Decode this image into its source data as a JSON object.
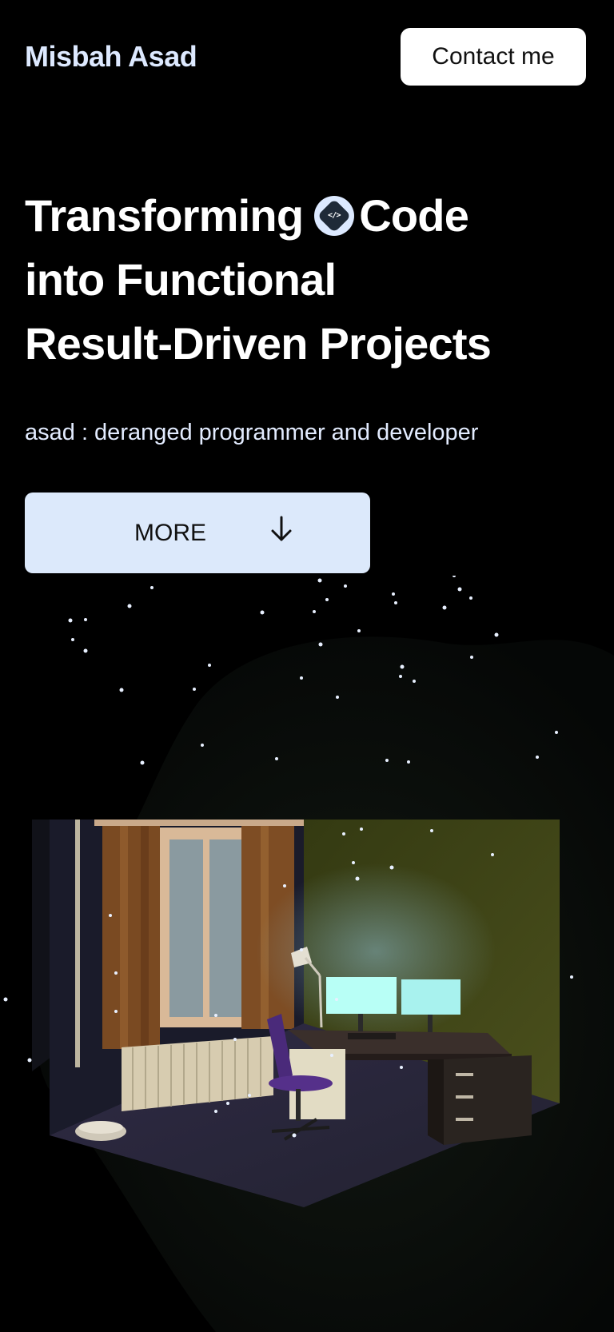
{
  "header": {
    "brand": "Misbah Asad",
    "contact_label": "Contact me"
  },
  "hero": {
    "line1_before_icon": "Transforming",
    "line1_after_icon": "Code",
    "line2": "into Functional",
    "line3": "Result-Driven Projects",
    "badge_text": "</>",
    "tagline": "asad : deranged programmer and developer"
  },
  "cta": {
    "more_label": "MORE",
    "more_icon": "arrow-down-icon"
  },
  "scene": {
    "description_icon": "room-illustration",
    "colors": {
      "left_wall": "#1c1e2e",
      "right_wall": "#3b4015",
      "floor": "#2c2b3a",
      "curtain": "#7a4c25",
      "monitor": "#a9fff8",
      "chair": "#4a2a7a"
    }
  }
}
